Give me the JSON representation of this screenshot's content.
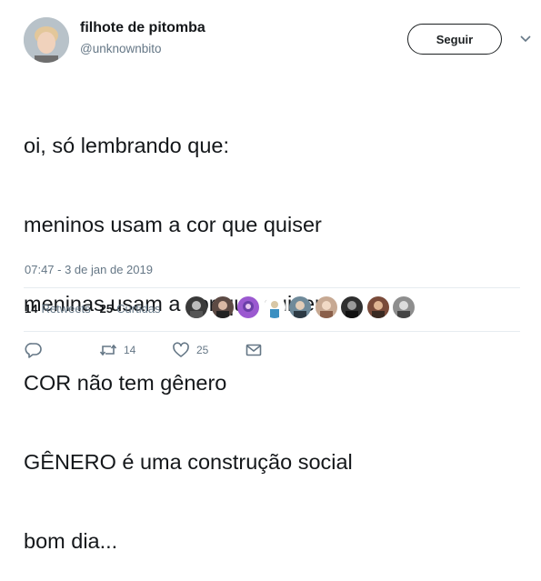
{
  "tweet": {
    "display_name": "filhote de pitomba",
    "username": "@unknownbito",
    "follow_label": "Seguir",
    "text_lines": [
      "oi, só lembrando que:",
      "meninos usam a cor que quiser",
      "meninas usam a cor que quiser",
      "COR não tem gênero",
      "GÊNERO é uma construção social",
      "bom dia..."
    ],
    "timestamp": "07:47 - 3 de jan de 2019"
  },
  "stats": {
    "retweets_count": "14",
    "retweets_label": "Retweets",
    "likes_count": "25",
    "likes_label": "Curtidas"
  },
  "likers": [
    {
      "name": "liker-1",
      "color": "#3a3a3a"
    },
    {
      "name": "liker-2",
      "color": "#5c4a44"
    },
    {
      "name": "liker-3",
      "color": "#9b59d0"
    },
    {
      "name": "liker-4",
      "color": "#d8c7a6"
    },
    {
      "name": "liker-5",
      "color": "#6f8a9a"
    },
    {
      "name": "liker-6",
      "color": "#c7a993"
    },
    {
      "name": "liker-7",
      "color": "#2f2f2f"
    },
    {
      "name": "liker-8",
      "color": "#7a4b3a"
    },
    {
      "name": "liker-9",
      "color": "#8e8e8e"
    }
  ],
  "actions": {
    "reply_icon": "reply-icon",
    "retweet_icon": "retweet-icon",
    "retweet_count": "14",
    "like_icon": "heart-icon",
    "like_count": "25",
    "dm_icon": "envelope-icon"
  },
  "colors": {
    "text": "#14171a",
    "muted": "#657786",
    "divider": "#e6ecf0"
  }
}
